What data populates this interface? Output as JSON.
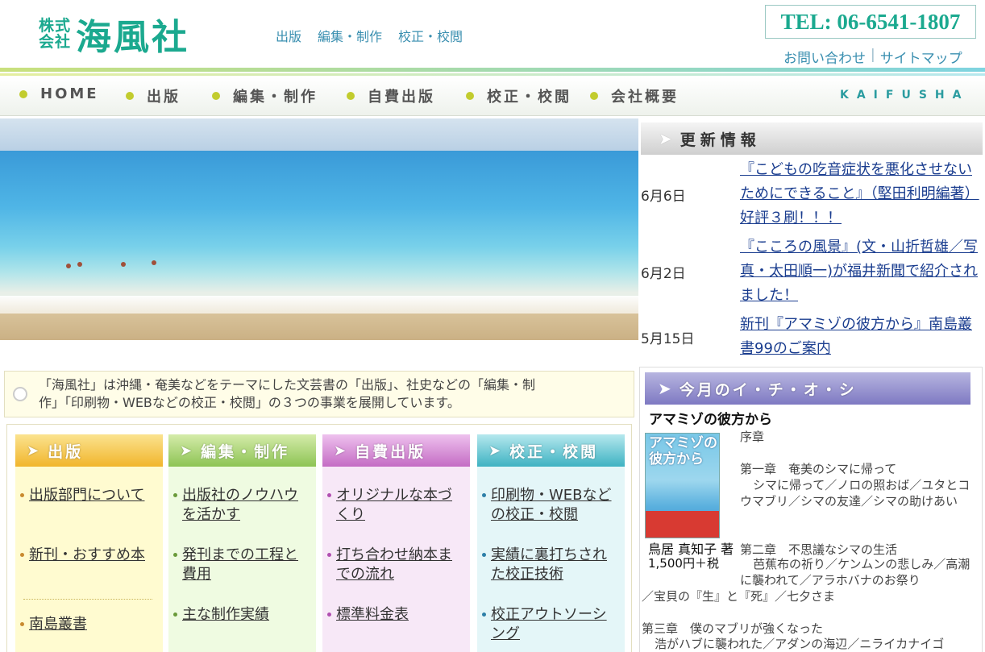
{
  "header": {
    "logo_kabu_top": "株式",
    "logo_kabu_bottom": "会社",
    "logo_name": "海風社",
    "links": [
      "出版",
      "編集・制作",
      "校正・校閲"
    ],
    "tel": "TEL: 06-6541-1807",
    "contact": "お問い合わせ",
    "separator": "|",
    "sitemap": "サイトマップ"
  },
  "nav": {
    "items": [
      "HOME",
      "出版",
      "編集・制作",
      "自費出版",
      "校正・校閲",
      "会社概要"
    ],
    "brand": "KAIFUSHA"
  },
  "updates": {
    "title": "更新情報",
    "items": [
      {
        "date": "6月6日",
        "text": "『こどもの吃音症状を悪化させないためにできること』（堅田利明編著）好評３刷！！！"
      },
      {
        "date": "6月2日",
        "text": "『こころの風景』(文・山折哲雄／写真・太田順一)が福井新聞で紹介されました！"
      },
      {
        "date": "5月15日",
        "text": "新刊『アマミゾの彼方から』南島叢書99のご案内"
      }
    ]
  },
  "intro": {
    "line1": "「海風社」は沖縄・奄美などをテーマにした文芸書の「出版」、社史などの「編集・制",
    "line2": "作」「印刷物・WEBなどの校正・校閲」の３つの事業を展開しています。"
  },
  "columns": [
    {
      "title": "出版",
      "items": [
        "出版部門について",
        "新刊・おすすめ本",
        "南島叢書"
      ]
    },
    {
      "title": "編集・制作",
      "items": [
        "出版社のノウハウを活かす",
        "発刊までの工程と費用",
        "主な制作実績"
      ]
    },
    {
      "title": "自費出版",
      "items": [
        "オリジナルな本づくり",
        "打ち合わせ納本までの流れ",
        "標準料金表"
      ]
    },
    {
      "title": "校正・校閲",
      "items": [
        "印刷物・WEBなどの校正・校閲",
        "実績に裏打ちされた校正技術",
        "校正アウトソーシング"
      ]
    }
  ],
  "ichioshi": {
    "title": "今月のイ・チ・オ・シ",
    "book_title": "アマミゾの彼方から",
    "cover_title": "アマミゾの彼方から",
    "author": "鳥居 真知子 著",
    "price": "1,500円＋税",
    "toc": {
      "preface": "序章",
      "ch1_title": "第一章　奄美のシマに帰って",
      "ch1_body": "シマに帰って／ノロの照おば／ユタとコウマブリ／シマの友達／シマの助けあい",
      "ch2_title": "第二章　不思議なシマの生活",
      "ch2_body": "芭蕉布の祈り／ケンムンの悲しみ／高潮に襲われて／アラホバナのお祭り",
      "ch2_cont": "／宝貝の『生』と『死』／七夕さま",
      "ch3_title": "第三章　僕のマブリが強くなった",
      "ch3_body": "浩がハブに襲われた／アダンの海辺／ニライカナイゴ"
    }
  },
  "colors": {
    "brand": "#1ba98f",
    "link_blue": "#1a3d8f",
    "nav_dot": "#c2cc2e",
    "col_publish": "#f4c94a",
    "col_edit": "#a8d46f",
    "col_self": "#d27fd2",
    "col_proof": "#5ac3cf"
  }
}
